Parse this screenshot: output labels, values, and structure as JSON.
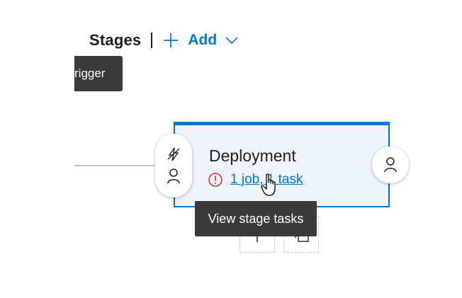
{
  "header": {
    "title": "Stages",
    "add_label": "Add"
  },
  "trigger_tooltip": {
    "text": "rigger"
  },
  "stage": {
    "name": "Deployment",
    "tasks_link": "1 job, 1 task"
  },
  "tooltip": {
    "text": "View stage tasks"
  },
  "icons": {
    "add": "plus-icon",
    "dropdown": "chevron-down-icon",
    "trigger": "lightning-icon",
    "pre_approval": "person-icon",
    "post_approval": "person-icon",
    "warning": "warning-circle-icon",
    "clone": "clone-icon",
    "cursor": "hand-pointer-icon"
  },
  "colors": {
    "accent": "#0078d4",
    "stage_bg": "#eef4fb",
    "warning": "#d13438",
    "tooltip_bg": "#3b3a39"
  }
}
